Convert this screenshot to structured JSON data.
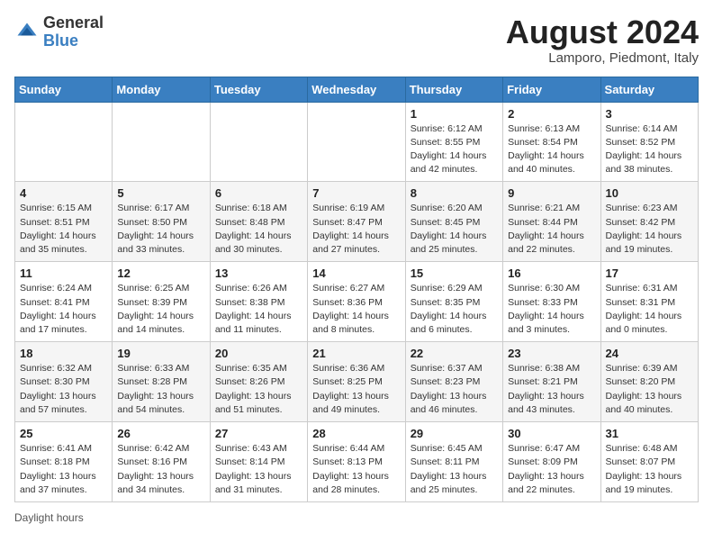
{
  "header": {
    "logo_general": "General",
    "logo_blue": "Blue",
    "month_year": "August 2024",
    "location": "Lamporo, Piedmont, Italy"
  },
  "footer": {
    "daylight_label": "Daylight hours"
  },
  "days_of_week": [
    "Sunday",
    "Monday",
    "Tuesday",
    "Wednesday",
    "Thursday",
    "Friday",
    "Saturday"
  ],
  "weeks": [
    [
      {
        "day": "",
        "info": ""
      },
      {
        "day": "",
        "info": ""
      },
      {
        "day": "",
        "info": ""
      },
      {
        "day": "",
        "info": ""
      },
      {
        "day": "1",
        "info": "Sunrise: 6:12 AM\nSunset: 8:55 PM\nDaylight: 14 hours and 42 minutes."
      },
      {
        "day": "2",
        "info": "Sunrise: 6:13 AM\nSunset: 8:54 PM\nDaylight: 14 hours and 40 minutes."
      },
      {
        "day": "3",
        "info": "Sunrise: 6:14 AM\nSunset: 8:52 PM\nDaylight: 14 hours and 38 minutes."
      }
    ],
    [
      {
        "day": "4",
        "info": "Sunrise: 6:15 AM\nSunset: 8:51 PM\nDaylight: 14 hours and 35 minutes."
      },
      {
        "day": "5",
        "info": "Sunrise: 6:17 AM\nSunset: 8:50 PM\nDaylight: 14 hours and 33 minutes."
      },
      {
        "day": "6",
        "info": "Sunrise: 6:18 AM\nSunset: 8:48 PM\nDaylight: 14 hours and 30 minutes."
      },
      {
        "day": "7",
        "info": "Sunrise: 6:19 AM\nSunset: 8:47 PM\nDaylight: 14 hours and 27 minutes."
      },
      {
        "day": "8",
        "info": "Sunrise: 6:20 AM\nSunset: 8:45 PM\nDaylight: 14 hours and 25 minutes."
      },
      {
        "day": "9",
        "info": "Sunrise: 6:21 AM\nSunset: 8:44 PM\nDaylight: 14 hours and 22 minutes."
      },
      {
        "day": "10",
        "info": "Sunrise: 6:23 AM\nSunset: 8:42 PM\nDaylight: 14 hours and 19 minutes."
      }
    ],
    [
      {
        "day": "11",
        "info": "Sunrise: 6:24 AM\nSunset: 8:41 PM\nDaylight: 14 hours and 17 minutes."
      },
      {
        "day": "12",
        "info": "Sunrise: 6:25 AM\nSunset: 8:39 PM\nDaylight: 14 hours and 14 minutes."
      },
      {
        "day": "13",
        "info": "Sunrise: 6:26 AM\nSunset: 8:38 PM\nDaylight: 14 hours and 11 minutes."
      },
      {
        "day": "14",
        "info": "Sunrise: 6:27 AM\nSunset: 8:36 PM\nDaylight: 14 hours and 8 minutes."
      },
      {
        "day": "15",
        "info": "Sunrise: 6:29 AM\nSunset: 8:35 PM\nDaylight: 14 hours and 6 minutes."
      },
      {
        "day": "16",
        "info": "Sunrise: 6:30 AM\nSunset: 8:33 PM\nDaylight: 14 hours and 3 minutes."
      },
      {
        "day": "17",
        "info": "Sunrise: 6:31 AM\nSunset: 8:31 PM\nDaylight: 14 hours and 0 minutes."
      }
    ],
    [
      {
        "day": "18",
        "info": "Sunrise: 6:32 AM\nSunset: 8:30 PM\nDaylight: 13 hours and 57 minutes."
      },
      {
        "day": "19",
        "info": "Sunrise: 6:33 AM\nSunset: 8:28 PM\nDaylight: 13 hours and 54 minutes."
      },
      {
        "day": "20",
        "info": "Sunrise: 6:35 AM\nSunset: 8:26 PM\nDaylight: 13 hours and 51 minutes."
      },
      {
        "day": "21",
        "info": "Sunrise: 6:36 AM\nSunset: 8:25 PM\nDaylight: 13 hours and 49 minutes."
      },
      {
        "day": "22",
        "info": "Sunrise: 6:37 AM\nSunset: 8:23 PM\nDaylight: 13 hours and 46 minutes."
      },
      {
        "day": "23",
        "info": "Sunrise: 6:38 AM\nSunset: 8:21 PM\nDaylight: 13 hours and 43 minutes."
      },
      {
        "day": "24",
        "info": "Sunrise: 6:39 AM\nSunset: 8:20 PM\nDaylight: 13 hours and 40 minutes."
      }
    ],
    [
      {
        "day": "25",
        "info": "Sunrise: 6:41 AM\nSunset: 8:18 PM\nDaylight: 13 hours and 37 minutes."
      },
      {
        "day": "26",
        "info": "Sunrise: 6:42 AM\nSunset: 8:16 PM\nDaylight: 13 hours and 34 minutes."
      },
      {
        "day": "27",
        "info": "Sunrise: 6:43 AM\nSunset: 8:14 PM\nDaylight: 13 hours and 31 minutes."
      },
      {
        "day": "28",
        "info": "Sunrise: 6:44 AM\nSunset: 8:13 PM\nDaylight: 13 hours and 28 minutes."
      },
      {
        "day": "29",
        "info": "Sunrise: 6:45 AM\nSunset: 8:11 PM\nDaylight: 13 hours and 25 minutes."
      },
      {
        "day": "30",
        "info": "Sunrise: 6:47 AM\nSunset: 8:09 PM\nDaylight: 13 hours and 22 minutes."
      },
      {
        "day": "31",
        "info": "Sunrise: 6:48 AM\nSunset: 8:07 PM\nDaylight: 13 hours and 19 minutes."
      }
    ]
  ]
}
